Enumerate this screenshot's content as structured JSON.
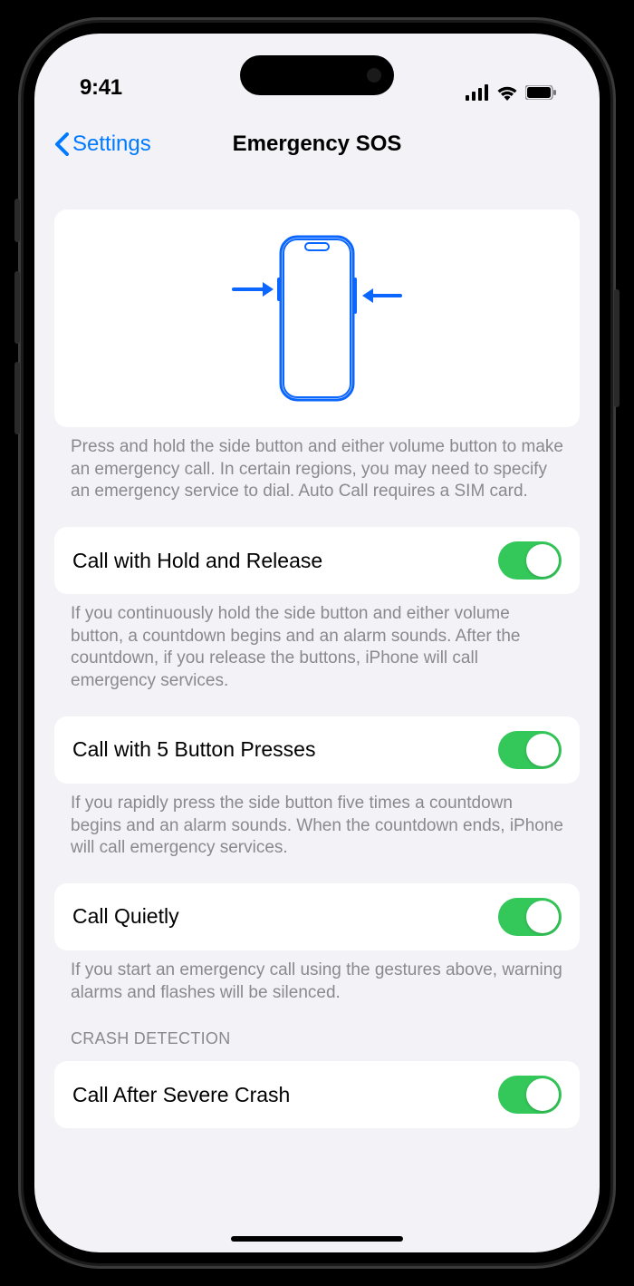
{
  "status": {
    "time": "9:41",
    "cellular_icon": "cellular-bars-icon",
    "wifi_icon": "wifi-icon",
    "battery_icon": "battery-icon"
  },
  "nav": {
    "back_label": "Settings",
    "title": "Emergency SOS"
  },
  "hero": {
    "description": "Press and hold the side button and either volume button to make an emergency call. In certain regions, you may need to specify an emergency service to dial. Auto Call requires a SIM card."
  },
  "settings": [
    {
      "label": "Call with Hold and Release",
      "enabled": true,
      "footer": "If you continuously hold the side button and either volume button, a countdown begins and an alarm sounds. After the countdown, if you release the buttons, iPhone will call emergency services."
    },
    {
      "label": "Call with 5 Button Presses",
      "enabled": true,
      "footer": "If you rapidly press the side button five times a countdown begins and an alarm sounds. When the countdown ends, iPhone will call emergency services."
    },
    {
      "label": "Call Quietly",
      "enabled": true,
      "footer": "If you start an emergency call using the gestures above, warning alarms and flashes will be silenced."
    }
  ],
  "crash_detection": {
    "header": "CRASH DETECTION",
    "label": "Call After Severe Crash",
    "enabled": true
  }
}
